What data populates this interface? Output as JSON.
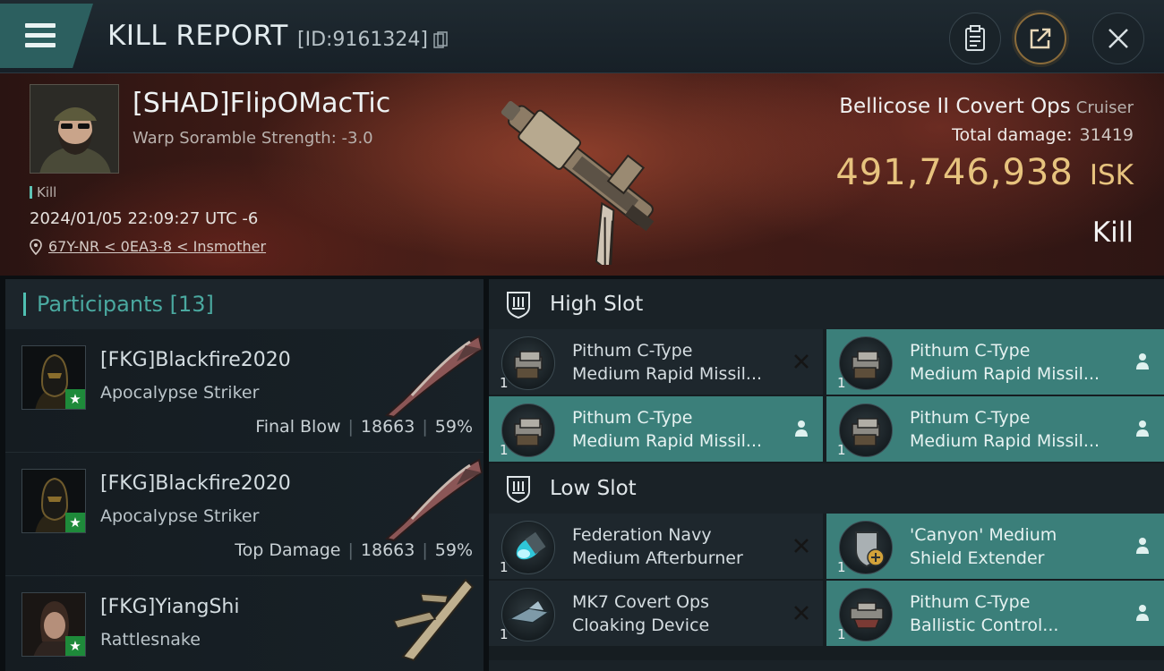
{
  "header": {
    "title": "KILL REPORT",
    "report_id": "[ID:9161324]",
    "icons": {
      "menu": "hamburger-menu-icon",
      "copy": "copy-icon",
      "report": "clipboard-icon",
      "share": "share-icon",
      "close": "close-icon"
    }
  },
  "victim": {
    "name": "[SHAD]FlipOMacTic",
    "scramble": "Warp Soramble Strength: -3.0",
    "tag": "Kill",
    "datetime": "2024/01/05 22:09:27 UTC -6",
    "location": "67Y-NR < 0EA3-8 < Insmother"
  },
  "ship": {
    "name": "Bellicose II Covert Ops",
    "class": "Cruiser",
    "total_damage_label": "Total damage:",
    "total_damage": "31419",
    "isk_value": "491,746,938",
    "isk_unit": "ISK",
    "result": "Kill"
  },
  "participants": {
    "label": "Participants",
    "count": "[13]",
    "rows": [
      {
        "name": "[FKG]Blackfire2020",
        "ship": "Apocalypse Striker",
        "role": "Final Blow",
        "damage": "18663",
        "percent": "59%"
      },
      {
        "name": "[FKG]Blackfire2020",
        "ship": "Apocalypse Striker",
        "role": "Top Damage",
        "damage": "18663",
        "percent": "59%"
      },
      {
        "name": "[FKG]YiangShi",
        "ship": "Rattlesnake",
        "role": "",
        "damage": "",
        "percent": ""
      }
    ]
  },
  "fitting": {
    "high_slot": {
      "label": "High Slot",
      "modules": [
        {
          "line1": "Pithum C-Type",
          "line2": "Medium Rapid Missil...",
          "qty": "1",
          "state": "destroyed",
          "state_icon": "x-icon",
          "highlight": false
        },
        {
          "line1": "Pithum C-Type",
          "line2": "Medium Rapid Missil...",
          "qty": "1",
          "state": "dropped",
          "state_icon": "person-icon",
          "highlight": true
        },
        {
          "line1": "Pithum C-Type",
          "line2": "Medium Rapid Missil...",
          "qty": "1",
          "state": "dropped",
          "state_icon": "person-icon",
          "highlight": true
        },
        {
          "line1": "Pithum C-Type",
          "line2": "Medium Rapid Missil...",
          "qty": "1",
          "state": "dropped",
          "state_icon": "person-icon",
          "highlight": true
        }
      ]
    },
    "low_slot": {
      "label": "Low Slot",
      "modules": [
        {
          "line1": "Federation Navy",
          "line2": "Medium Afterburner",
          "qty": "1",
          "state": "destroyed",
          "state_icon": "x-icon",
          "highlight": false
        },
        {
          "line1": "'Canyon' Medium",
          "line2": "Shield Extender",
          "qty": "1",
          "state": "dropped",
          "state_icon": "person-icon",
          "highlight": true
        },
        {
          "line1": "MK7 Covert Ops",
          "line2": "Cloaking Device",
          "qty": "1",
          "state": "destroyed",
          "state_icon": "x-icon",
          "highlight": false
        },
        {
          "line1": "Pithum C-Type",
          "line2": "Ballistic Control...",
          "qty": "1",
          "state": "dropped",
          "state_icon": "person-icon",
          "highlight": true
        }
      ]
    }
  },
  "colors": {
    "accent_teal": "#3b7f7a",
    "isk_gold": "#e7c37e",
    "header_tab": "#2c5f5f"
  }
}
